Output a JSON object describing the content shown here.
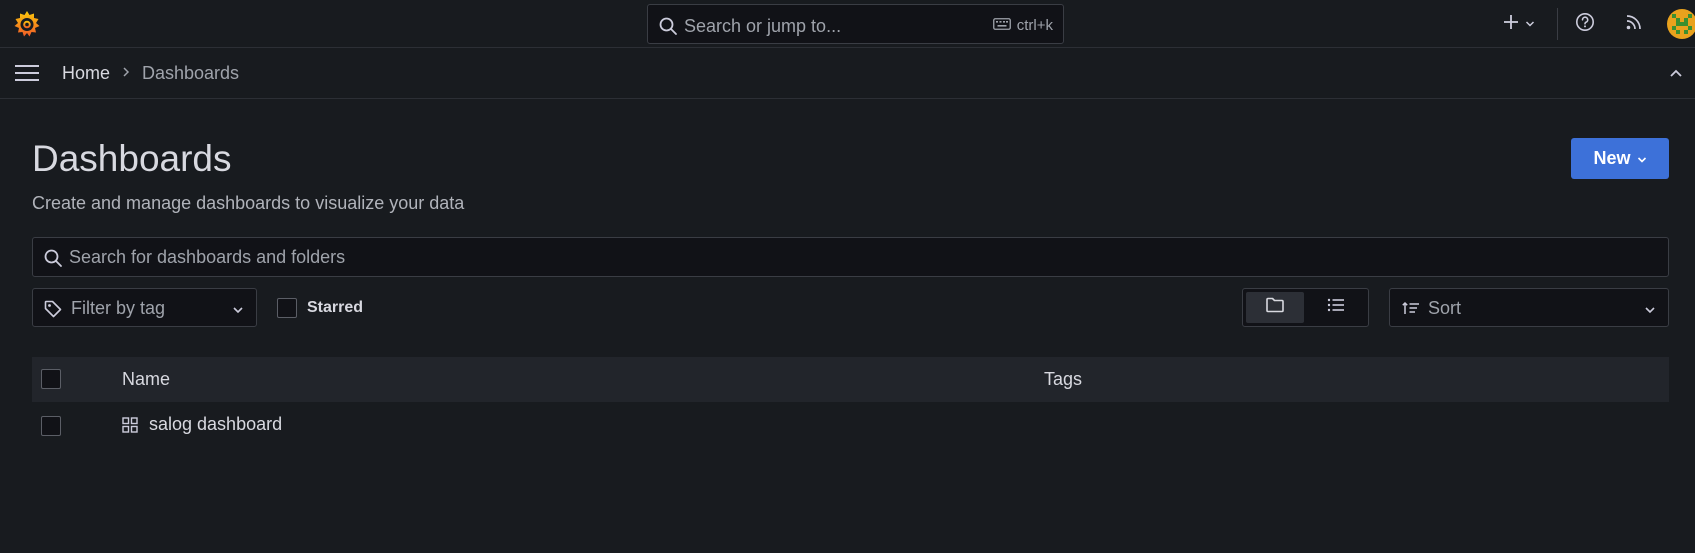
{
  "topbar": {
    "search_placeholder": "Search or jump to...",
    "search_shortcut": "ctrl+k",
    "icons": [
      "grafana-logo-icon",
      "search-icon",
      "keyboard-icon",
      "plus-icon",
      "chevron-down-icon",
      "help-icon",
      "news-rss-icon",
      "avatar"
    ]
  },
  "breadcrumb": {
    "home": "Home",
    "current": "Dashboards"
  },
  "page": {
    "title": "Dashboards",
    "subtitle": "Create and manage dashboards to visualize your data",
    "new_button": "New"
  },
  "filters": {
    "search_placeholder": "Search for dashboards and folders",
    "tag_filter": "Filter by tag",
    "starred_label": "Starred",
    "starred_checked": false,
    "view_mode": "folder",
    "sort_label": "Sort"
  },
  "table": {
    "columns": [
      "Name",
      "Tags"
    ],
    "rows": [
      {
        "name": "salog dashboard",
        "tags": ""
      }
    ]
  },
  "colors": {
    "background": "#181b1f",
    "accent": "#3d71d9",
    "logo": "#f46800"
  }
}
